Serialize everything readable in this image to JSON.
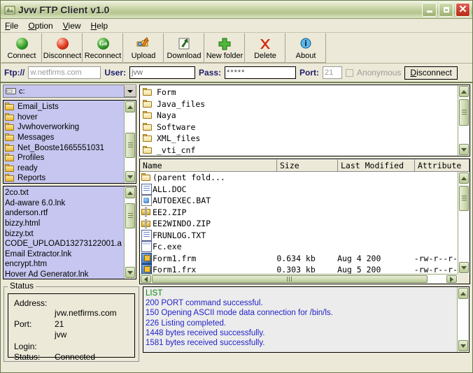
{
  "window": {
    "title": "Jvw FTP Client v1.0",
    "icon": "app-icon",
    "minimize": "–",
    "maximize": "□",
    "close": "✕"
  },
  "menu": {
    "items": [
      {
        "label": "File",
        "accel": "F"
      },
      {
        "label": "Option",
        "accel": "O"
      },
      {
        "label": "View",
        "accel": "V"
      },
      {
        "label": "Help",
        "accel": "H"
      }
    ]
  },
  "toolbar": {
    "buttons": [
      {
        "label": "Connect",
        "icon": "green-sphere-icon"
      },
      {
        "label": "Disconnect",
        "icon": "red-sphere-icon"
      },
      {
        "label": "Reconnect",
        "icon": "go-circle-icon"
      },
      {
        "label": "Upload",
        "icon": "upload-arrow-icon"
      },
      {
        "label": "Download",
        "icon": "download-arrow-icon"
      },
      {
        "label": "New folder",
        "icon": "green-plus-icon"
      },
      {
        "label": "Delete",
        "icon": "red-x-icon"
      },
      {
        "label": "About",
        "icon": "blue-info-icon"
      }
    ],
    "go_text": "Go"
  },
  "connection": {
    "ftp_label": "Ftp://",
    "host_value": "w.netfirms.com",
    "user_label": "User:",
    "user_value": "jvw",
    "pass_label": "Pass:",
    "pass_value": "*****",
    "port_label": "Port:",
    "port_value": "21",
    "anonymous_label": "Anonymous",
    "disconnect_label": "Disconnect",
    "disconnect_accel": "D"
  },
  "local": {
    "drive_value": "c:",
    "folders": [
      "Email_Lists",
      "hover",
      "Jvwhoverworking",
      "Messages",
      "Net_Booste1665551031",
      "Profiles",
      "ready",
      "Reports"
    ],
    "files": [
      "2co.txt",
      "Ad-aware 6.0.lnk",
      "anderson.rtf",
      "bizzy.html",
      "bizzy.txt",
      "CODE_UPLOAD13273122001.a",
      "Email Extractor.lnk",
      "encrypt.htm",
      "Hover Ad Generator.lnk"
    ]
  },
  "remote": {
    "folders": [
      "Form",
      "Java_files",
      "Naya",
      "Software",
      "XML_files",
      "_vti_cnf"
    ],
    "columns": [
      "Name",
      "Size",
      "Last Modified",
      "Attribute"
    ],
    "rows": [
      {
        "name": "(parent fold...",
        "icon": "folder-icon",
        "size": "",
        "modified": "",
        "attribute": ""
      },
      {
        "name": "ALL.DOC",
        "icon": "doc-file-icon",
        "size": "",
        "modified": "",
        "attribute": ""
      },
      {
        "name": "AUTOEXEC.BAT",
        "icon": "bat-file-icon",
        "size": "",
        "modified": "",
        "attribute": ""
      },
      {
        "name": "EE2.ZIP",
        "icon": "zip-file-icon",
        "size": "",
        "modified": "",
        "attribute": ""
      },
      {
        "name": "EE2WINDO.ZIP",
        "icon": "zip-file-icon",
        "size": "",
        "modified": "",
        "attribute": ""
      },
      {
        "name": "FRUNLOG.TXT",
        "icon": "doc-file-icon",
        "size": "",
        "modified": "",
        "attribute": ""
      },
      {
        "name": "Fc.exe",
        "icon": "exe-file-icon",
        "size": "",
        "modified": "",
        "attribute": ""
      },
      {
        "name": "Form1.frm",
        "icon": "vb-file-icon",
        "size": "0.634 kb",
        "modified": "Aug  4  200",
        "attribute": "-rw-r--r-"
      },
      {
        "name": "Form1.frx",
        "icon": "vb-file-icon",
        "size": "0.303 kb",
        "modified": "Aug  5  200",
        "attribute": "-rw-r--r-"
      }
    ]
  },
  "status": {
    "legend": "Status",
    "address_label": "Address:",
    "address_value": "jvw.netfirms.com",
    "port_label": "Port:",
    "port_value": "21",
    "login_label": "Login:",
    "login_value": "jvw",
    "status_label": "Status:",
    "status_value": "Connected"
  },
  "log": {
    "lines": [
      {
        "text": "LIST",
        "color": "green"
      },
      {
        "text": "200 PORT command successful.",
        "color": "blue"
      },
      {
        "text": "150 Opening ASCII mode data connection for /bin/ls.",
        "color": "blue"
      },
      {
        "text": "226 Listing completed.",
        "color": "blue"
      },
      {
        "text": "1448 bytes received successfully.",
        "color": "blue"
      },
      {
        "text": "1581 bytes received successfully.",
        "color": "blue"
      }
    ]
  },
  "colors": {
    "titlebar": "#b5c48e",
    "face": "#ece9d8",
    "list_lavender": "#c6c6f0",
    "label_navy": "#1d1d6e",
    "log_blue": "#2323c8",
    "log_green": "#0a8a0a",
    "close_red": "#b62b17"
  }
}
